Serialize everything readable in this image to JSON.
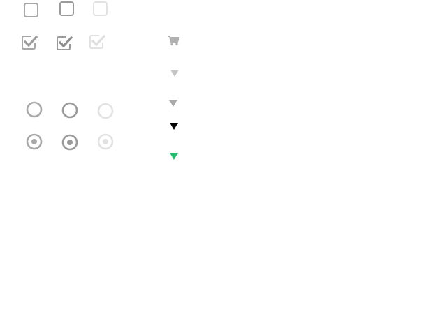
{
  "colors": {
    "normal": "#a8a8a8",
    "hover": "#9a9a9a",
    "disabled": "#e2e2e2",
    "check_normal": "#9e9e9e",
    "check_hover": "#8c8c8c",
    "check_disabled": "#e0e0e0",
    "cart": "#b0b0b0",
    "arrow_light": "#c4c4c4",
    "arrow_mid": "#ababab",
    "arrow_dark": "#000000",
    "arrow_accent": "#1dbb6a"
  },
  "checkboxes": {
    "unchecked": [
      {
        "state": "normal",
        "icon": "checkbox-unchecked-icon"
      },
      {
        "state": "hover",
        "icon": "checkbox-unchecked-icon"
      },
      {
        "state": "disabled",
        "icon": "checkbox-unchecked-icon"
      }
    ],
    "checked": [
      {
        "state": "normal",
        "icon": "checkbox-checked-icon"
      },
      {
        "state": "hover",
        "icon": "checkbox-checked-icon"
      },
      {
        "state": "disabled",
        "icon": "checkbox-checked-icon"
      }
    ]
  },
  "radios": {
    "unselected": [
      {
        "state": "normal",
        "icon": "radio-unselected-icon"
      },
      {
        "state": "hover",
        "icon": "radio-unselected-icon"
      },
      {
        "state": "disabled",
        "icon": "radio-unselected-icon"
      }
    ],
    "selected": [
      {
        "state": "normal",
        "icon": "radio-selected-icon"
      },
      {
        "state": "hover",
        "icon": "radio-selected-icon"
      },
      {
        "state": "disabled",
        "icon": "radio-selected-icon"
      }
    ]
  },
  "icons": {
    "cart": "shopping-cart-icon",
    "arrows": [
      "triangle-down-icon",
      "triangle-down-icon",
      "triangle-down-icon",
      "triangle-down-icon"
    ]
  }
}
